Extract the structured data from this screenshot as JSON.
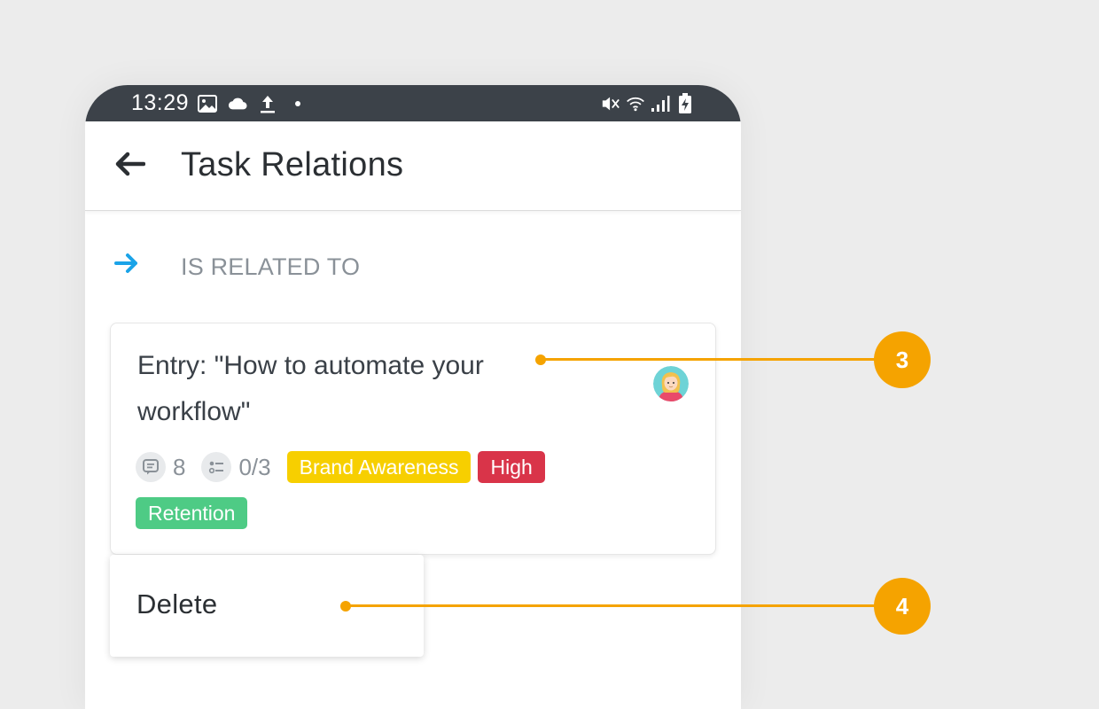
{
  "status_bar": {
    "time": "13:29",
    "left_icons": [
      "image-icon",
      "cloud-icon",
      "upload-icon",
      "dot-icon"
    ],
    "right_icons": [
      "mute-icon",
      "wifi-icon",
      "signal-icon",
      "battery-charging-icon"
    ]
  },
  "app_bar": {
    "back_icon": "arrow-left-icon",
    "title": "Task Relations"
  },
  "section": {
    "icon": "arrow-right-icon",
    "label": "IS RELATED TO"
  },
  "task_card": {
    "title": "Entry: \"How to automate your workflow\"",
    "avatar": "user-avatar",
    "comments_count": "8",
    "checklist": "0/3",
    "tags": [
      {
        "label": "Brand Awareness",
        "color": "#f7cf00"
      },
      {
        "label": "High",
        "color": "#d93449"
      },
      {
        "label": "Retention",
        "color": "#4ecb85"
      }
    ]
  },
  "context_menu": {
    "items": [
      {
        "label": "Delete"
      }
    ]
  },
  "callouts": [
    {
      "number": "3"
    },
    {
      "number": "4"
    }
  ],
  "colors": {
    "accent_arrow": "#1aa3e8",
    "callout": "#f5a300",
    "status_bar": "#3c4249"
  }
}
